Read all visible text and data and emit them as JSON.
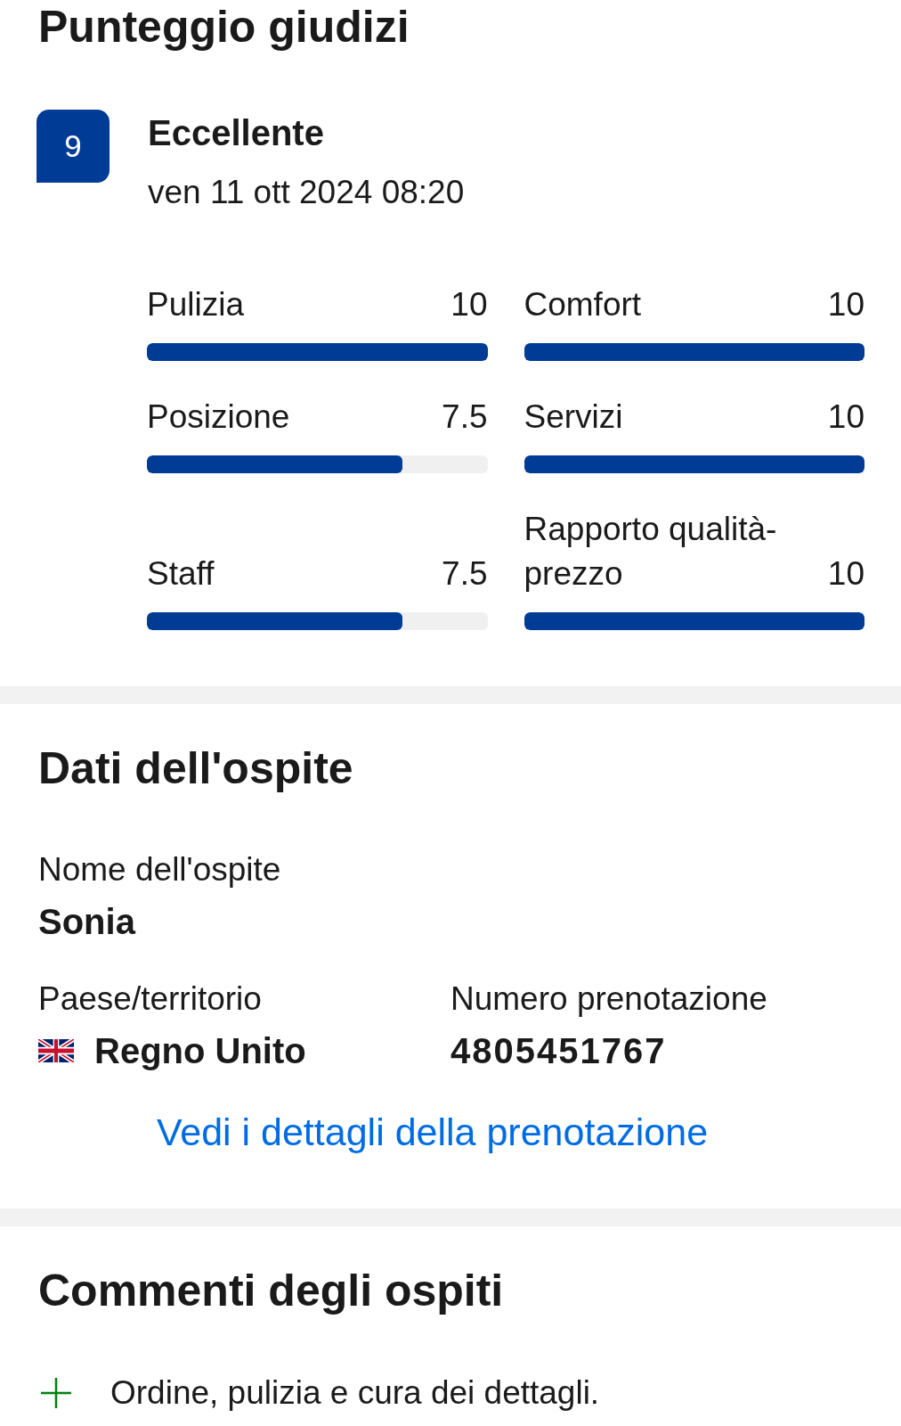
{
  "rating": {
    "title": "Punteggio giudizi",
    "score": "9",
    "verdict": "Eccellente",
    "date": "ven 11 ott 2024 08:20",
    "categories": [
      {
        "label": "Pulizia",
        "value": "10",
        "level": 1
      },
      {
        "label": "Posizione",
        "value": "7.5",
        "level": 0.75
      },
      {
        "label": "Staff",
        "value": "7.5",
        "level": 0.75
      },
      {
        "label": "Comfort",
        "value": "10",
        "level": 1
      },
      {
        "label": "Servizi",
        "value": "10",
        "level": 1
      },
      {
        "label": "Rapporto qualità-prezzo",
        "value": "10",
        "level": 1
      }
    ]
  },
  "guest": {
    "title": "Dati dell'ospite",
    "name": {
      "label": "Nome dell'ospite",
      "value": "Sonia"
    },
    "country": {
      "label": "Paese/territorio",
      "value": "Regno Unito"
    },
    "booking_number": {
      "label": "Numero prenotazione",
      "value": "4805451767"
    },
    "link": "Vedi i dettagli della prenotazione"
  },
  "comments": {
    "title": "Commenti degli ospiti",
    "items": [
      {
        "kind": "positive",
        "text": "Ordine, pulizia e cura dei dettagli."
      }
    ]
  }
}
